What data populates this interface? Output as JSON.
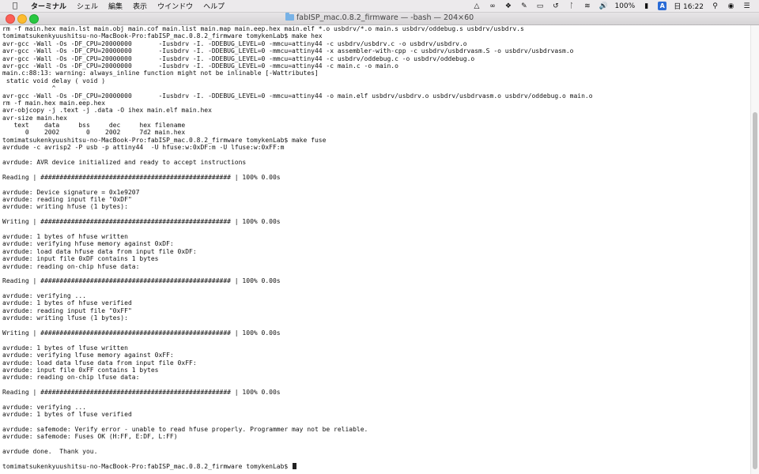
{
  "menubar": {
    "apple_icon": "apple-icon",
    "app_name": "ターミナル",
    "items": [
      "シェル",
      "編集",
      "表示",
      "ウインドウ",
      "ヘルプ"
    ],
    "battery": "100%",
    "input_source": "A",
    "clock": "日 16:22"
  },
  "window": {
    "title": "fabISP_mac.0.8.2_firmware — -bash — 204×60"
  },
  "terminal": {
    "lines": [
      "rm -f main.hex main.lst main.obj main.cof main.list main.map main.eep.hex main.elf *.o usbdrv/*.o main.s usbdrv/oddebug.s usbdrv/usbdrv.s",
      "tomimatsukenkyuushitsu-no-MacBook-Pro:fabISP_mac.0.8.2_firmware tomykenLab$ make hex",
      "avr-gcc -Wall -Os -DF_CPU=20000000       -Iusbdrv -I. -DDEBUG_LEVEL=0 -mmcu=attiny44 -c usbdrv/usbdrv.c -o usbdrv/usbdrv.o",
      "avr-gcc -Wall -Os -DF_CPU=20000000       -Iusbdrv -I. -DDEBUG_LEVEL=0 -mmcu=attiny44 -x assembler-with-cpp -c usbdrv/usbdrvasm.S -o usbdrv/usbdrvasm.o",
      "avr-gcc -Wall -Os -DF_CPU=20000000       -Iusbdrv -I. -DDEBUG_LEVEL=0 -mmcu=attiny44 -c usbdrv/oddebug.c -o usbdrv/oddebug.o",
      "avr-gcc -Wall -Os -DF_CPU=20000000       -Iusbdrv -I. -DDEBUG_LEVEL=0 -mmcu=attiny44 -c main.c -o main.o",
      "main.c:88:13: warning: always_inline function might not be inlinable [-Wattributes]",
      " static void delay ( void )",
      "             ^",
      "avr-gcc -Wall -Os -DF_CPU=20000000       -Iusbdrv -I. -DDEBUG_LEVEL=0 -mmcu=attiny44 -o main.elf usbdrv/usbdrv.o usbdrv/usbdrvasm.o usbdrv/oddebug.o main.o",
      "rm -f main.hex main.eep.hex",
      "avr-objcopy -j .text -j .data -O ihex main.elf main.hex",
      "avr-size main.hex",
      "   text    data     bss     dec     hex filename",
      "      0    2002       0    2002     7d2 main.hex",
      "tomimatsukenkyuushitsu-no-MacBook-Pro:fabISP_mac.0.8.2_firmware tomykenLab$ make fuse",
      "avrdude -c avrisp2 -P usb -p attiny44  -U hfuse:w:0xDF:m -U lfuse:w:0xFF:m",
      "",
      "avrdude: AVR device initialized and ready to accept instructions",
      "",
      "Reading | ################################################## | 100% 0.00s",
      "",
      "avrdude: Device signature = 0x1e9207",
      "avrdude: reading input file \"0xDF\"",
      "avrdude: writing hfuse (1 bytes):",
      "",
      "Writing | ################################################## | 100% 0.00s",
      "",
      "avrdude: 1 bytes of hfuse written",
      "avrdude: verifying hfuse memory against 0xDF:",
      "avrdude: load data hfuse data from input file 0xDF:",
      "avrdude: input file 0xDF contains 1 bytes",
      "avrdude: reading on-chip hfuse data:",
      "",
      "Reading | ################################################## | 100% 0.00s",
      "",
      "avrdude: verifying ...",
      "avrdude: 1 bytes of hfuse verified",
      "avrdude: reading input file \"0xFF\"",
      "avrdude: writing lfuse (1 bytes):",
      "",
      "Writing | ################################################## | 100% 0.00s",
      "",
      "avrdude: 1 bytes of lfuse written",
      "avrdude: verifying lfuse memory against 0xFF:",
      "avrdude: load data lfuse data from input file 0xFF:",
      "avrdude: input file 0xFF contains 1 bytes",
      "avrdude: reading on-chip lfuse data:",
      "",
      "Reading | ################################################## | 100% 0.00s",
      "",
      "avrdude: verifying ...",
      "avrdude: 1 bytes of lfuse verified",
      "",
      "avrdude: safemode: Verify error - unable to read hfuse properly. Programmer may not be reliable.",
      "avrdude: safemode: Fuses OK (H:FF, E:DF, L:FF)",
      "",
      "avrdude done.  Thank you.",
      "",
      "tomimatsukenkyuushitsu-no-MacBook-Pro:fabISP_mac.0.8.2_firmware tomykenLab$ "
    ]
  }
}
